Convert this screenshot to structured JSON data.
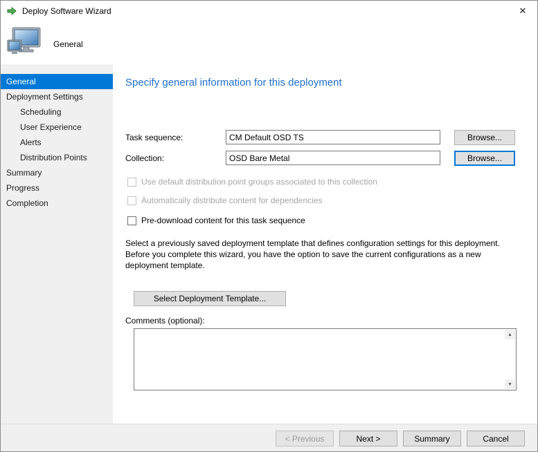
{
  "window": {
    "title": "Deploy Software Wizard",
    "close_glyph": "✕"
  },
  "header": {
    "page_label": "General"
  },
  "sidebar": {
    "items": [
      {
        "label": "General",
        "selected": true,
        "indent": false
      },
      {
        "label": "Deployment Settings",
        "selected": false,
        "indent": false
      },
      {
        "label": "Scheduling",
        "selected": false,
        "indent": true
      },
      {
        "label": "User Experience",
        "selected": false,
        "indent": true
      },
      {
        "label": "Alerts",
        "selected": false,
        "indent": true
      },
      {
        "label": "Distribution Points",
        "selected": false,
        "indent": true
      },
      {
        "label": "Summary",
        "selected": false,
        "indent": false
      },
      {
        "label": "Progress",
        "selected": false,
        "indent": false
      },
      {
        "label": "Completion",
        "selected": false,
        "indent": false
      }
    ]
  },
  "main": {
    "heading": "Specify general information for this deployment",
    "fields": [
      {
        "label": "Task sequence:",
        "value": "CM Default OSD TS",
        "button": "Browse..."
      },
      {
        "label": "Collection:",
        "value": "OSD Bare Metal",
        "button": "Browse..."
      }
    ],
    "checkboxes": [
      {
        "label": "Use default distribution point groups associated to this collection",
        "disabled": true,
        "checked": false
      },
      {
        "label": "Automatically distribute content for dependencies",
        "disabled": true,
        "checked": false
      },
      {
        "label": "Pre-download content for this task sequence",
        "disabled": false,
        "checked": false
      }
    ],
    "template_note": "Select a previously saved deployment template that defines configuration settings for this deployment. Before you complete this wizard, you have the option to save the current configurations as a new deployment template.",
    "template_button": "Select Deployment Template...",
    "comments_label": "Comments (optional):",
    "comments_value": ""
  },
  "icons": {
    "scroll_up": "▲",
    "scroll_down": "▼"
  },
  "footer": {
    "buttons": [
      {
        "label": "< Previous",
        "disabled": true
      },
      {
        "label": "Next >",
        "disabled": false
      },
      {
        "label": "Summary",
        "disabled": false
      },
      {
        "label": "Cancel",
        "disabled": false
      }
    ]
  },
  "colors": {
    "accent": "#0078d7",
    "heading_blue": "#1e6fc8",
    "sidebar_bg": "#f0f0f0",
    "button_face": "#e1e1e1",
    "disabled_text": "#a6a6a6",
    "deploy_arrow_green": "#4caf50"
  }
}
